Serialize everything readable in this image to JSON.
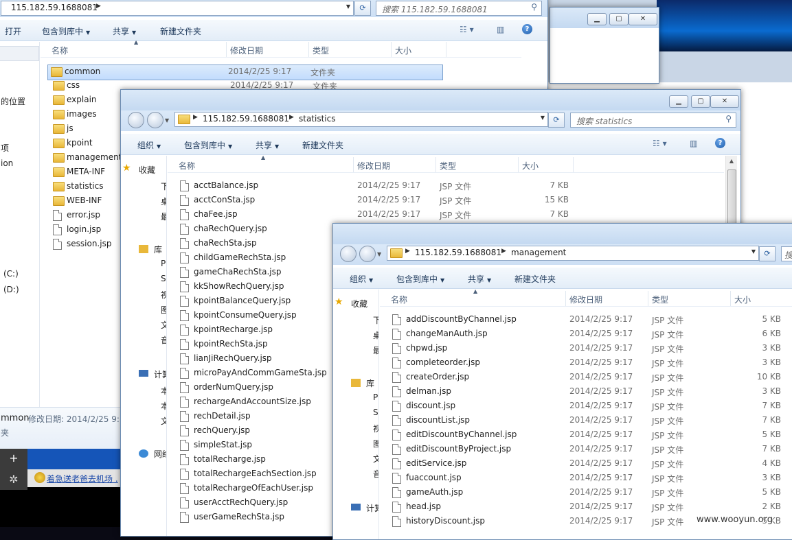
{
  "colors": {
    "accent": "#1e395b",
    "selection": "#c2dcfd"
  },
  "back_window": {
    "address": "115.182.59.1688081",
    "search_placeholder": "搜索 115.182.59.1688081",
    "toolbar": {
      "open": "打开",
      "include": "包含到库中",
      "share": "共享",
      "new_folder": "新建文件夹"
    },
    "columns": {
      "name": "名称",
      "date": "修改日期",
      "type": "类型",
      "size": "大小"
    },
    "nav_fragments": [
      "的位置",
      "项",
      "ion",
      "(C:)",
      "(D:)"
    ],
    "rows": [
      {
        "name": "common",
        "date": "2014/2/25 9:17",
        "type": "文件夹",
        "kind": "dir",
        "selected": true
      },
      {
        "name": "css",
        "date": "2014/2/25 9:17",
        "type": "文件夹",
        "kind": "dir"
      },
      {
        "name": "explain",
        "kind": "dir"
      },
      {
        "name": "images",
        "kind": "dir"
      },
      {
        "name": "js",
        "kind": "dir"
      },
      {
        "name": "kpoint",
        "kind": "dir"
      },
      {
        "name": "management",
        "kind": "dir"
      },
      {
        "name": "META-INF",
        "kind": "dir"
      },
      {
        "name": "statistics",
        "kind": "dir"
      },
      {
        "name": "WEB-INF",
        "kind": "dir"
      },
      {
        "name": "error.jsp",
        "kind": "file"
      },
      {
        "name": "login.jsp",
        "kind": "file"
      },
      {
        "name": "session.jsp",
        "kind": "file"
      }
    ],
    "status": {
      "name": "mmon",
      "label": "修改日期: 2014/2/25 9:1",
      "type": "夹"
    }
  },
  "taskbar": {
    "item": "着急送老爸去机场 .",
    "add": "+",
    "gear": "✲"
  },
  "statistics_window": {
    "address_root": "115.182.59.1688081",
    "address_folder": "statistics",
    "search_placeholder": "搜索 statistics",
    "toolbar": {
      "organize": "组织",
      "include": "包含到库中",
      "share": "共享",
      "new_folder": "新建文件夹"
    },
    "columns": {
      "name": "名称",
      "date": "修改日期",
      "type": "类型",
      "size": "大小"
    },
    "nav": {
      "favorites": "收藏",
      "libraries": "库",
      "computer": "计算",
      "network": "网络"
    },
    "nav_frag": [
      "下",
      "桌",
      "最",
      "P",
      "S",
      "视",
      "图",
      "文",
      "音",
      "本",
      "本",
      "文"
    ],
    "rows": [
      {
        "name": "acctBalance.jsp",
        "date": "2014/2/25 9:17",
        "type": "JSP 文件",
        "size": "7 KB"
      },
      {
        "name": "acctConSta.jsp",
        "date": "2014/2/25 9:17",
        "type": "JSP 文件",
        "size": "15 KB"
      },
      {
        "name": "chaFee.jsp",
        "date": "2014/2/25 9:17",
        "type": "JSP 文件",
        "size": "7 KB"
      },
      {
        "name": "chaRechQuery.jsp"
      },
      {
        "name": "chaRechSta.jsp"
      },
      {
        "name": "childGameRechSta.jsp"
      },
      {
        "name": "gameChaRechSta.jsp"
      },
      {
        "name": "kkShowRechQuery.jsp"
      },
      {
        "name": "kpointBalanceQuery.jsp"
      },
      {
        "name": "kpointConsumeQuery.jsp"
      },
      {
        "name": "kpointRecharge.jsp"
      },
      {
        "name": "kpointRechSta.jsp"
      },
      {
        "name": "lianJiRechQuery.jsp"
      },
      {
        "name": "microPayAndCommGameSta.jsp"
      },
      {
        "name": "orderNumQuery.jsp"
      },
      {
        "name": "rechargeAndAccountSize.jsp"
      },
      {
        "name": "rechDetail.jsp"
      },
      {
        "name": "rechQuery.jsp"
      },
      {
        "name": "simpleStat.jsp"
      },
      {
        "name": "totalRecharge.jsp"
      },
      {
        "name": "totalRechargeEachSection.jsp"
      },
      {
        "name": "totalRechargeOfEachUser.jsp"
      },
      {
        "name": "userAcctRechQuery.jsp"
      },
      {
        "name": "userGameRechSta.jsp"
      }
    ]
  },
  "management_window": {
    "address_root": "115.182.59.1688081",
    "address_folder": "management",
    "toolbar": {
      "organize": "组织",
      "include": "包含到库中",
      "share": "共享",
      "new_folder": "新建文件夹"
    },
    "columns": {
      "name": "名称",
      "date": "修改日期",
      "type": "类型",
      "size": "大小"
    },
    "nav": {
      "favorites": "收藏",
      "libraries": "库",
      "computer": "计算"
    },
    "nav_frag": [
      "下",
      "桌",
      "最",
      "P",
      "S",
      "视",
      "图",
      "文",
      "音"
    ],
    "rows": [
      {
        "name": "addDiscountByChannel.jsp",
        "date": "2014/2/25 9:17",
        "type": "JSP 文件",
        "size": "5 KB"
      },
      {
        "name": "changeManAuth.jsp",
        "date": "2014/2/25 9:17",
        "type": "JSP 文件",
        "size": "6 KB"
      },
      {
        "name": "chpwd.jsp",
        "date": "2014/2/25 9:17",
        "type": "JSP 文件",
        "size": "3 KB"
      },
      {
        "name": "completeorder.jsp",
        "date": "2014/2/25 9:17",
        "type": "JSP 文件",
        "size": "3 KB"
      },
      {
        "name": "createOrder.jsp",
        "date": "2014/2/25 9:17",
        "type": "JSP 文件",
        "size": "10 KB"
      },
      {
        "name": "delman.jsp",
        "date": "2014/2/25 9:17",
        "type": "JSP 文件",
        "size": "3 KB"
      },
      {
        "name": "discount.jsp",
        "date": "2014/2/25 9:17",
        "type": "JSP 文件",
        "size": "7 KB"
      },
      {
        "name": "discountList.jsp",
        "date": "2014/2/25 9:17",
        "type": "JSP 文件",
        "size": "7 KB"
      },
      {
        "name": "editDiscountByChannel.jsp",
        "date": "2014/2/25 9:17",
        "type": "JSP 文件",
        "size": "5 KB"
      },
      {
        "name": "editDiscountByProject.jsp",
        "date": "2014/2/25 9:17",
        "type": "JSP 文件",
        "size": "7 KB"
      },
      {
        "name": "editService.jsp",
        "date": "2014/2/25 9:17",
        "type": "JSP 文件",
        "size": "4 KB"
      },
      {
        "name": "fuaccount.jsp",
        "date": "2014/2/25 9:17",
        "type": "JSP 文件",
        "size": "3 KB"
      },
      {
        "name": "gameAuth.jsp",
        "date": "2014/2/25 9:17",
        "type": "JSP 文件",
        "size": "5 KB"
      },
      {
        "name": "head.jsp",
        "date": "2014/2/25 9:17",
        "type": "JSP 文件",
        "size": "2 KB"
      },
      {
        "name": "historyDiscount.jsp",
        "date": "2014/2/25 9:17",
        "type": "JSP 文件",
        "size": "5 KB"
      }
    ]
  },
  "watermark": "www.wooyun.org"
}
